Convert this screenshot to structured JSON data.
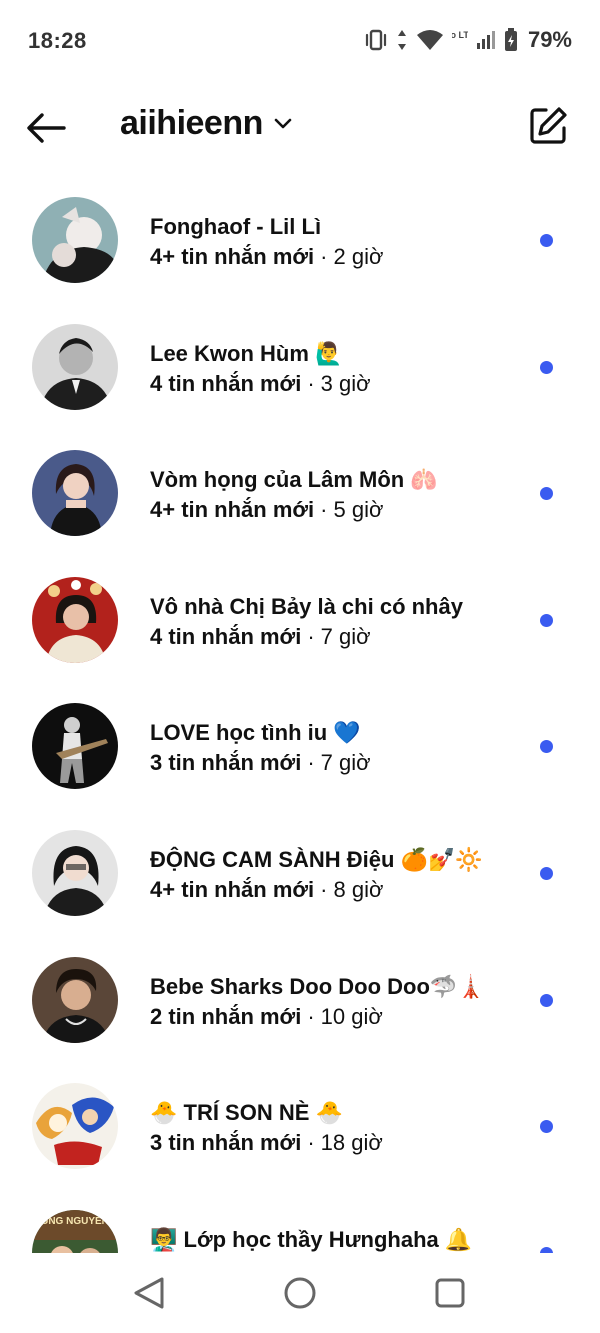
{
  "status_bar": {
    "time": "18:28",
    "battery": "79%",
    "network_label": "Vo LTE",
    "icons": [
      "vibrate-icon",
      "data-arrows-icon",
      "wifi-icon",
      "volte-icon",
      "signal-icon",
      "battery-icon"
    ]
  },
  "header": {
    "title": "aiihieenn",
    "icons": [
      "back-arrow-icon",
      "chevron-down-icon",
      "compose-icon"
    ]
  },
  "conversations": [
    {
      "name": "Fonghaof - Lil Lì",
      "count": "4+ tin nhắn mới",
      "time": "2 giờ",
      "unread": true,
      "avatar_color": "#8fb0b4"
    },
    {
      "name": "Lee Kwon Hùm 🙋‍♂️",
      "count": "4 tin nhắn mới",
      "time": "3 giờ",
      "unread": true,
      "avatar_color": "#2a2a2a"
    },
    {
      "name": "Vòm họng của Lâm Môn 🫁",
      "count": "4+ tin nhắn mới",
      "time": "5 giờ",
      "unread": true,
      "avatar_color": "#4a5a8a"
    },
    {
      "name": "Vô nhà Chị Bảy là chi có nhây",
      "count": "4 tin nhắn mới",
      "time": "7 giờ",
      "unread": true,
      "avatar_color": "#b2221c"
    },
    {
      "name": "LOVE học tình iu 💙",
      "count": "3 tin nhắn mới",
      "time": "7 giờ",
      "unread": true,
      "avatar_color": "#0e0e0e"
    },
    {
      "name": "ĐỘNG CAM SÀNH Điệu 🍊💅🔆",
      "count": "4+ tin nhắn mới",
      "time": "8 giờ",
      "unread": true,
      "avatar_color": "#d8d8d8"
    },
    {
      "name": "Bebe Sharks Doo Doo Doo🦈🗼",
      "count": "2 tin nhắn mới",
      "time": "10 giờ",
      "unread": true,
      "avatar_color": "#5a4638"
    },
    {
      "name": "🐣 TRÍ SON NÈ 🐣",
      "count": "3 tin nhắn mới",
      "time": "18 giờ",
      "unread": true,
      "avatar_color": "#e9a33a"
    },
    {
      "name": "👨‍🏫 Lớp học thầy Hưnghaha 🔔",
      "count": "",
      "time": "",
      "unread": true,
      "avatar_color": "#3b5a32",
      "avatar_text": "UNG NGUYEN"
    }
  ],
  "nav_bar": {
    "icons": [
      "nav-back-icon",
      "nav-home-icon",
      "nav-recent-icon"
    ]
  }
}
